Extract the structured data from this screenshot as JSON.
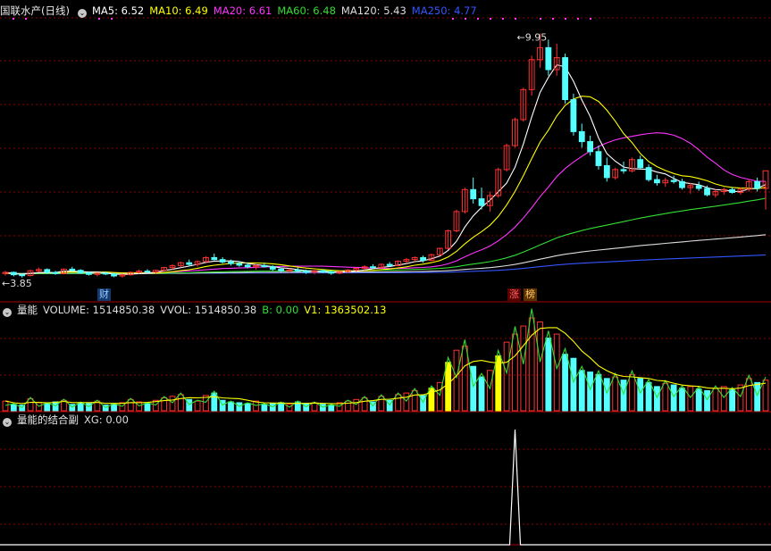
{
  "main": {
    "title": "国联水产(日线)",
    "legend": [
      {
        "text": "MA5: 6.52",
        "color": "#ffffff"
      },
      {
        "text": "MA10: 6.49",
        "color": "#ffff00"
      },
      {
        "text": "MA20: 6.61",
        "color": "#ff33ff"
      },
      {
        "text": "MA60: 6.48",
        "color": "#33dd33"
      },
      {
        "text": "MA120: 5.43",
        "color": "#dddddd"
      },
      {
        "text": "MA250: 4.77",
        "color": "#3355ff"
      }
    ],
    "badge_cai": "财",
    "badge_zhang": "涨",
    "badge_bang": "榜"
  },
  "volume": {
    "title": "量能",
    "legend": [
      {
        "text": "VOLUME: 1514850.38",
        "color": "#dddddd"
      },
      {
        "text": "VVOL: 1514850.38",
        "color": "#dddddd"
      },
      {
        "text": "B: 0.00",
        "color": "#33dd33"
      },
      {
        "text": "V1: 1363502.13",
        "color": "#ffff00"
      }
    ]
  },
  "xg": {
    "title": "量能的结合副",
    "legend": [
      {
        "text": "XG: 0.00",
        "color": "#dddddd"
      }
    ]
  },
  "colors": {
    "up": "#ff3232",
    "down": "#54ffff",
    "grid": "#8b0000",
    "ma5": "#ffffff",
    "ma10": "#ffff00",
    "ma20": "#ff33ff",
    "ma60": "#33dd33",
    "ma120": "#dddddd",
    "ma250": "#3355ff"
  },
  "chart_data": {
    "type": "candlestick",
    "high_label": "9.95",
    "low_label": "3.85",
    "ohlc": [
      [
        3.95,
        4.02,
        3.9,
        3.98
      ],
      [
        3.98,
        4.0,
        3.88,
        3.92
      ],
      [
        3.92,
        3.96,
        3.85,
        3.9
      ],
      [
        3.9,
        4.05,
        3.88,
        4.02
      ],
      [
        4.02,
        4.1,
        3.98,
        4.05
      ],
      [
        4.05,
        4.08,
        3.95,
        3.98
      ],
      [
        3.98,
        4.02,
        3.92,
        3.95
      ],
      [
        3.95,
        4.08,
        3.93,
        4.06
      ],
      [
        4.06,
        4.12,
        4.0,
        4.03
      ],
      [
        4.03,
        4.06,
        3.95,
        3.97
      ],
      [
        3.97,
        4.0,
        3.9,
        3.93
      ],
      [
        3.93,
        3.98,
        3.88,
        3.96
      ],
      [
        3.96,
        4.0,
        3.91,
        3.94
      ],
      [
        3.94,
        3.97,
        3.86,
        3.89
      ],
      [
        3.89,
        3.94,
        3.85,
        3.92
      ],
      [
        3.92,
        4.0,
        3.9,
        3.98
      ],
      [
        3.98,
        4.05,
        3.95,
        4.01
      ],
      [
        4.01,
        4.06,
        3.96,
        3.99
      ],
      [
        3.99,
        4.05,
        3.95,
        4.03
      ],
      [
        4.03,
        4.12,
        4.0,
        4.1
      ],
      [
        4.1,
        4.18,
        4.05,
        4.15
      ],
      [
        4.15,
        4.25,
        4.1,
        4.22
      ],
      [
        4.22,
        4.3,
        4.15,
        4.18
      ],
      [
        4.18,
        4.28,
        4.12,
        4.25
      ],
      [
        4.25,
        4.38,
        4.2,
        4.35
      ],
      [
        4.35,
        4.45,
        4.28,
        4.3
      ],
      [
        4.3,
        4.36,
        4.2,
        4.24
      ],
      [
        4.24,
        4.3,
        4.15,
        4.2
      ],
      [
        4.2,
        4.26,
        4.12,
        4.16
      ],
      [
        4.16,
        4.22,
        4.08,
        4.12
      ],
      [
        4.12,
        4.18,
        4.05,
        4.15
      ],
      [
        4.15,
        4.22,
        4.1,
        4.12
      ],
      [
        4.12,
        4.16,
        4.02,
        4.06
      ],
      [
        4.06,
        4.1,
        3.98,
        4.02
      ],
      [
        4.02,
        4.08,
        3.96,
        4.04
      ],
      [
        4.04,
        4.1,
        3.99,
        4.01
      ],
      [
        4.01,
        4.05,
        3.94,
        3.98
      ],
      [
        3.98,
        4.04,
        3.93,
        4.02
      ],
      [
        4.02,
        4.06,
        3.96,
        3.99
      ],
      [
        3.99,
        4.03,
        3.92,
        3.96
      ],
      [
        3.96,
        4.02,
        3.93,
        4.0
      ],
      [
        4.0,
        4.06,
        3.96,
        4.04
      ],
      [
        4.04,
        4.1,
        4.0,
        4.08
      ],
      [
        4.08,
        4.16,
        4.04,
        4.12
      ],
      [
        4.12,
        4.18,
        4.06,
        4.1
      ],
      [
        4.1,
        4.2,
        4.08,
        4.18
      ],
      [
        4.18,
        4.24,
        4.12,
        4.15
      ],
      [
        4.15,
        4.28,
        4.13,
        4.26
      ],
      [
        4.26,
        4.34,
        4.2,
        4.3
      ],
      [
        4.3,
        4.38,
        4.25,
        4.35
      ],
      [
        4.35,
        4.4,
        4.22,
        4.28
      ],
      [
        4.28,
        4.45,
        4.26,
        4.42
      ],
      [
        4.42,
        4.6,
        4.4,
        4.58
      ],
      [
        4.58,
        5.05,
        4.55,
        5.02
      ],
      [
        5.02,
        5.55,
        4.98,
        5.5
      ],
      [
        5.5,
        6.1,
        5.45,
        6.05
      ],
      [
        6.05,
        6.35,
        5.7,
        5.82
      ],
      [
        5.82,
        6.1,
        5.55,
        5.65
      ],
      [
        5.65,
        6.0,
        5.5,
        5.9
      ],
      [
        5.9,
        6.6,
        5.85,
        6.55
      ],
      [
        6.55,
        7.2,
        6.5,
        7.15
      ],
      [
        7.15,
        7.85,
        7.1,
        7.8
      ],
      [
        7.8,
        8.6,
        7.75,
        8.55
      ],
      [
        8.55,
        9.4,
        8.4,
        9.3
      ],
      [
        9.3,
        9.95,
        9.1,
        9.6
      ],
      [
        9.6,
        9.8,
        8.9,
        9.05
      ],
      [
        9.05,
        9.7,
        8.9,
        9.35
      ],
      [
        9.35,
        9.45,
        8.2,
        8.3
      ],
      [
        8.3,
        8.45,
        7.4,
        7.5
      ],
      [
        7.5,
        7.7,
        7.1,
        7.25
      ],
      [
        7.25,
        7.4,
        6.9,
        7.0
      ],
      [
        7.0,
        7.15,
        6.55,
        6.65
      ],
      [
        6.65,
        6.85,
        6.25,
        6.35
      ],
      [
        6.35,
        6.6,
        6.3,
        6.55
      ],
      [
        6.55,
        6.75,
        6.45,
        6.52
      ],
      [
        6.52,
        6.85,
        6.48,
        6.8
      ],
      [
        6.8,
        6.9,
        6.55,
        6.6
      ],
      [
        6.6,
        6.68,
        6.25,
        6.3
      ],
      [
        6.3,
        6.42,
        6.15,
        6.22
      ],
      [
        6.22,
        6.35,
        6.12,
        6.28
      ],
      [
        6.28,
        6.4,
        6.2,
        6.25
      ],
      [
        6.25,
        6.32,
        6.05,
        6.1
      ],
      [
        6.1,
        6.22,
        5.95,
        6.15
      ],
      [
        6.15,
        6.25,
        6.02,
        6.08
      ],
      [
        6.08,
        6.15,
        5.88,
        5.92
      ],
      [
        5.92,
        6.05,
        5.85,
        6.0
      ],
      [
        6.0,
        6.1,
        5.92,
        6.05
      ],
      [
        6.05,
        6.12,
        5.95,
        5.98
      ],
      [
        5.98,
        6.1,
        5.92,
        6.06
      ],
      [
        6.06,
        6.3,
        6.0,
        6.25
      ],
      [
        6.25,
        6.35,
        6.0,
        6.08
      ],
      [
        6.08,
        6.25,
        5.55,
        6.52
      ]
    ],
    "volume": [
      12,
      8,
      7,
      15,
      10,
      9,
      11,
      13,
      8,
      10,
      9,
      12,
      7,
      8,
      10,
      14,
      11,
      9,
      13,
      16,
      18,
      20,
      14,
      12,
      19,
      22,
      13,
      11,
      10,
      9,
      12,
      8,
      9,
      10,
      8,
      11,
      9,
      10,
      8,
      7,
      10,
      12,
      14,
      16,
      11,
      18,
      13,
      20,
      22,
      25,
      19,
      28,
      35,
      60,
      75,
      80,
      55,
      42,
      50,
      68,
      85,
      95,
      105,
      115,
      110,
      90,
      95,
      70,
      65,
      50,
      48,
      45,
      40,
      42,
      38,
      45,
      40,
      35,
      30,
      34,
      32,
      28,
      30,
      27,
      25,
      28,
      30,
      26,
      32,
      40,
      35,
      38
    ],
    "xg_spike_index": 61
  }
}
